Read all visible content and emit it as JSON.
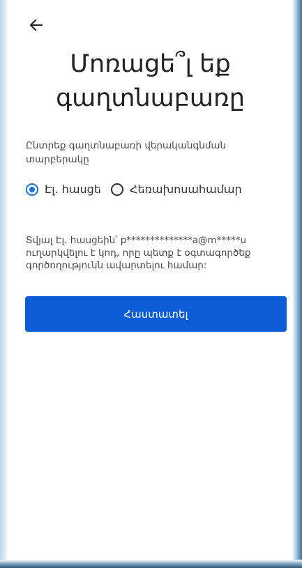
{
  "header": {
    "back_icon": "arrow-left-icon",
    "title": "Մոռացե՞լ եք\nգաղտնաբառը"
  },
  "recovery": {
    "instruction": "Ընտրեք գաղտնաբառի վերականգնման տարբերակը",
    "options": [
      {
        "label": "Էլ. հասցե",
        "selected": true
      },
      {
        "label": "Հեռախոսահամար",
        "selected": false
      }
    ],
    "info_text": "Տվյալ Էլ. հասցեին՝ p**************a@m*****u ուղարկվելու է կոդ, որը պետք է օգտագործեք գործողությունն ավարտելու համար:"
  },
  "actions": {
    "confirm_label": "Հաստատել"
  },
  "colors": {
    "accent": "#0b5cd6",
    "radio_selected": "#1a73e8",
    "text_primary": "#222222",
    "text_secondary": "#4a4a4a"
  }
}
